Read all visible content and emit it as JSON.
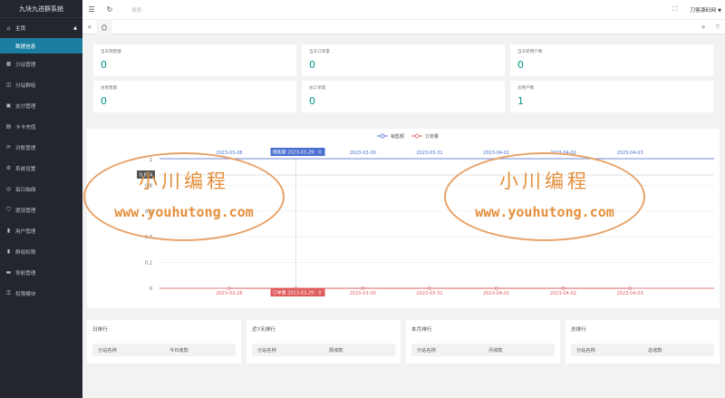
{
  "app": {
    "title": "九块九进群系统"
  },
  "sidebar": {
    "main": {
      "label": "主页",
      "sub": "数据信息"
    },
    "items": [
      {
        "label": "分站管理",
        "icon": "grid-icon"
      },
      {
        "label": "分站群组",
        "icon": "group-icon"
      },
      {
        "label": "支付管理",
        "icon": "wallet-icon"
      },
      {
        "label": "卡卡充值",
        "icon": "card-icon"
      },
      {
        "label": "对账管理",
        "icon": "refresh-icon"
      },
      {
        "label": "系统设置",
        "icon": "gear-icon"
      },
      {
        "label": "每日抽佣",
        "icon": "target-icon"
      },
      {
        "label": "提现管理",
        "icon": "shield-icon"
      },
      {
        "label": "用户管理",
        "icon": "user-icon"
      },
      {
        "label": "群组权限",
        "icon": "users-icon"
      },
      {
        "label": "导航管理",
        "icon": "nav-icon"
      },
      {
        "label": "权限模块",
        "icon": "module-icon"
      }
    ]
  },
  "topbar": {
    "search_placeholder": "搜索...",
    "user": "刀客源码网"
  },
  "stats": [
    {
      "label": "当天销售额",
      "value": "0"
    },
    {
      "label": "当天订单量",
      "value": "0"
    },
    {
      "label": "当天新用户数",
      "value": "0"
    },
    {
      "label": "总销售额",
      "value": "0"
    },
    {
      "label": "总订单量",
      "value": "0"
    },
    {
      "label": "总用户数",
      "value": "1"
    }
  ],
  "chart_data": {
    "type": "line",
    "categories": [
      "2023-03-28",
      "2023-03-29",
      "2023-03-30",
      "2023-03-31",
      "2023-04-01",
      "2023-04-02",
      "2023-04-03"
    ],
    "series": [
      {
        "name": "销售额",
        "values": [
          0,
          0,
          0,
          0,
          0,
          0,
          0
        ],
        "color": "#4a6fd0"
      },
      {
        "name": "订单量",
        "values": [
          0,
          0,
          0,
          0,
          0,
          0,
          0
        ],
        "color": "#e05b5b"
      }
    ],
    "ylim": [
      0,
      1
    ],
    "yticks": [
      "0",
      "0.2",
      "0.4",
      "0.6",
      "0.8",
      "1"
    ],
    "pointer": {
      "category": "2023-03-29",
      "top_label": "销售额",
      "top_text": "2023-03-29：0",
      "bottom_label": "订单量",
      "bottom_text": "2023-03-29：0",
      "y_readout": "0.874"
    },
    "legend": "top-center"
  },
  "ranks": [
    {
      "title": "日排行",
      "col1": "分站名称",
      "col2": "今日收款"
    },
    {
      "title": "近7天排行",
      "col1": "分站名称",
      "col2": "周收款"
    },
    {
      "title": "本月排行",
      "col1": "分站名称",
      "col2": "月收款"
    },
    {
      "title": "总排行",
      "col1": "分站名称",
      "col2": "总收款"
    }
  ],
  "watermark": {
    "cn": "小川编程",
    "url": "www.youhutong.com"
  }
}
